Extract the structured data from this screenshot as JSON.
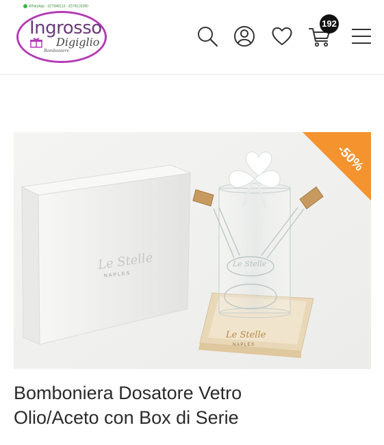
{
  "header": {
    "whatsapp_label": "WhatsApp : 327/846113 - 327/6133390",
    "logo_line1": "Ingrosso",
    "logo_line2": "Digiglio",
    "logo_line3": "Bomboniere",
    "cart_count": "192",
    "icons": [
      "search-icon",
      "account-icon",
      "wishlist-heart-icon",
      "cart-icon",
      "hamburger-menu-icon"
    ]
  },
  "product": {
    "discount_badge": "-50%",
    "box_brand": "Le Stelle",
    "box_city": "NAPLES",
    "tray_brand": "Le Stelle",
    "tray_city": "NAPLES",
    "bottle_brand": "Le Stelle",
    "title_line1": "Bomboniera Dosatore Vetro",
    "title_line2": "Olio/Aceto con Box di Serie",
    "colors": {
      "badge": "#f5932e",
      "logo_oval": "#b23bb5"
    }
  }
}
